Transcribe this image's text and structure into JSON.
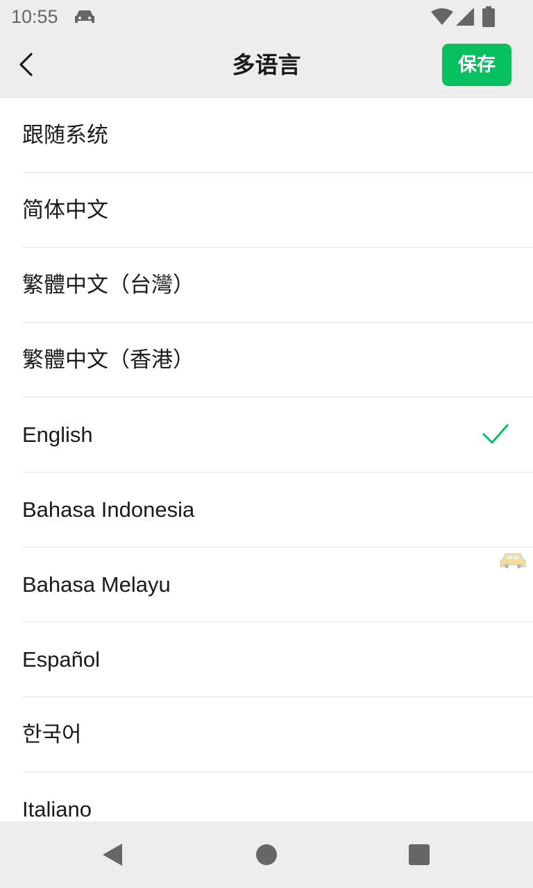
{
  "status_bar": {
    "time": "10:55",
    "icons": [
      "notification-app-icon",
      "wifi-icon",
      "cell-signal-icon",
      "battery-icon"
    ]
  },
  "header": {
    "title": "多语言",
    "save_label": "保存",
    "back_icon": "chevron-left-icon"
  },
  "languages": [
    {
      "label": "跟随系统",
      "selected": false
    },
    {
      "label": "简体中文",
      "selected": false
    },
    {
      "label": "繁體中文（台灣）",
      "selected": false
    },
    {
      "label": "繁體中文（香港）",
      "selected": false
    },
    {
      "label": "English",
      "selected": true
    },
    {
      "label": "Bahasa Indonesia",
      "selected": false
    },
    {
      "label": "Bahasa Melayu",
      "selected": false
    },
    {
      "label": "Español",
      "selected": false
    },
    {
      "label": "한국어",
      "selected": false
    },
    {
      "label": "Italiano",
      "selected": false
    }
  ],
  "colors": {
    "accent": "#07c160",
    "header_bg": "#ededed",
    "divider": "#e5e5e5"
  },
  "nav_bar": {
    "icons": [
      "back-triangle-icon",
      "home-circle-icon",
      "recents-square-icon"
    ]
  }
}
